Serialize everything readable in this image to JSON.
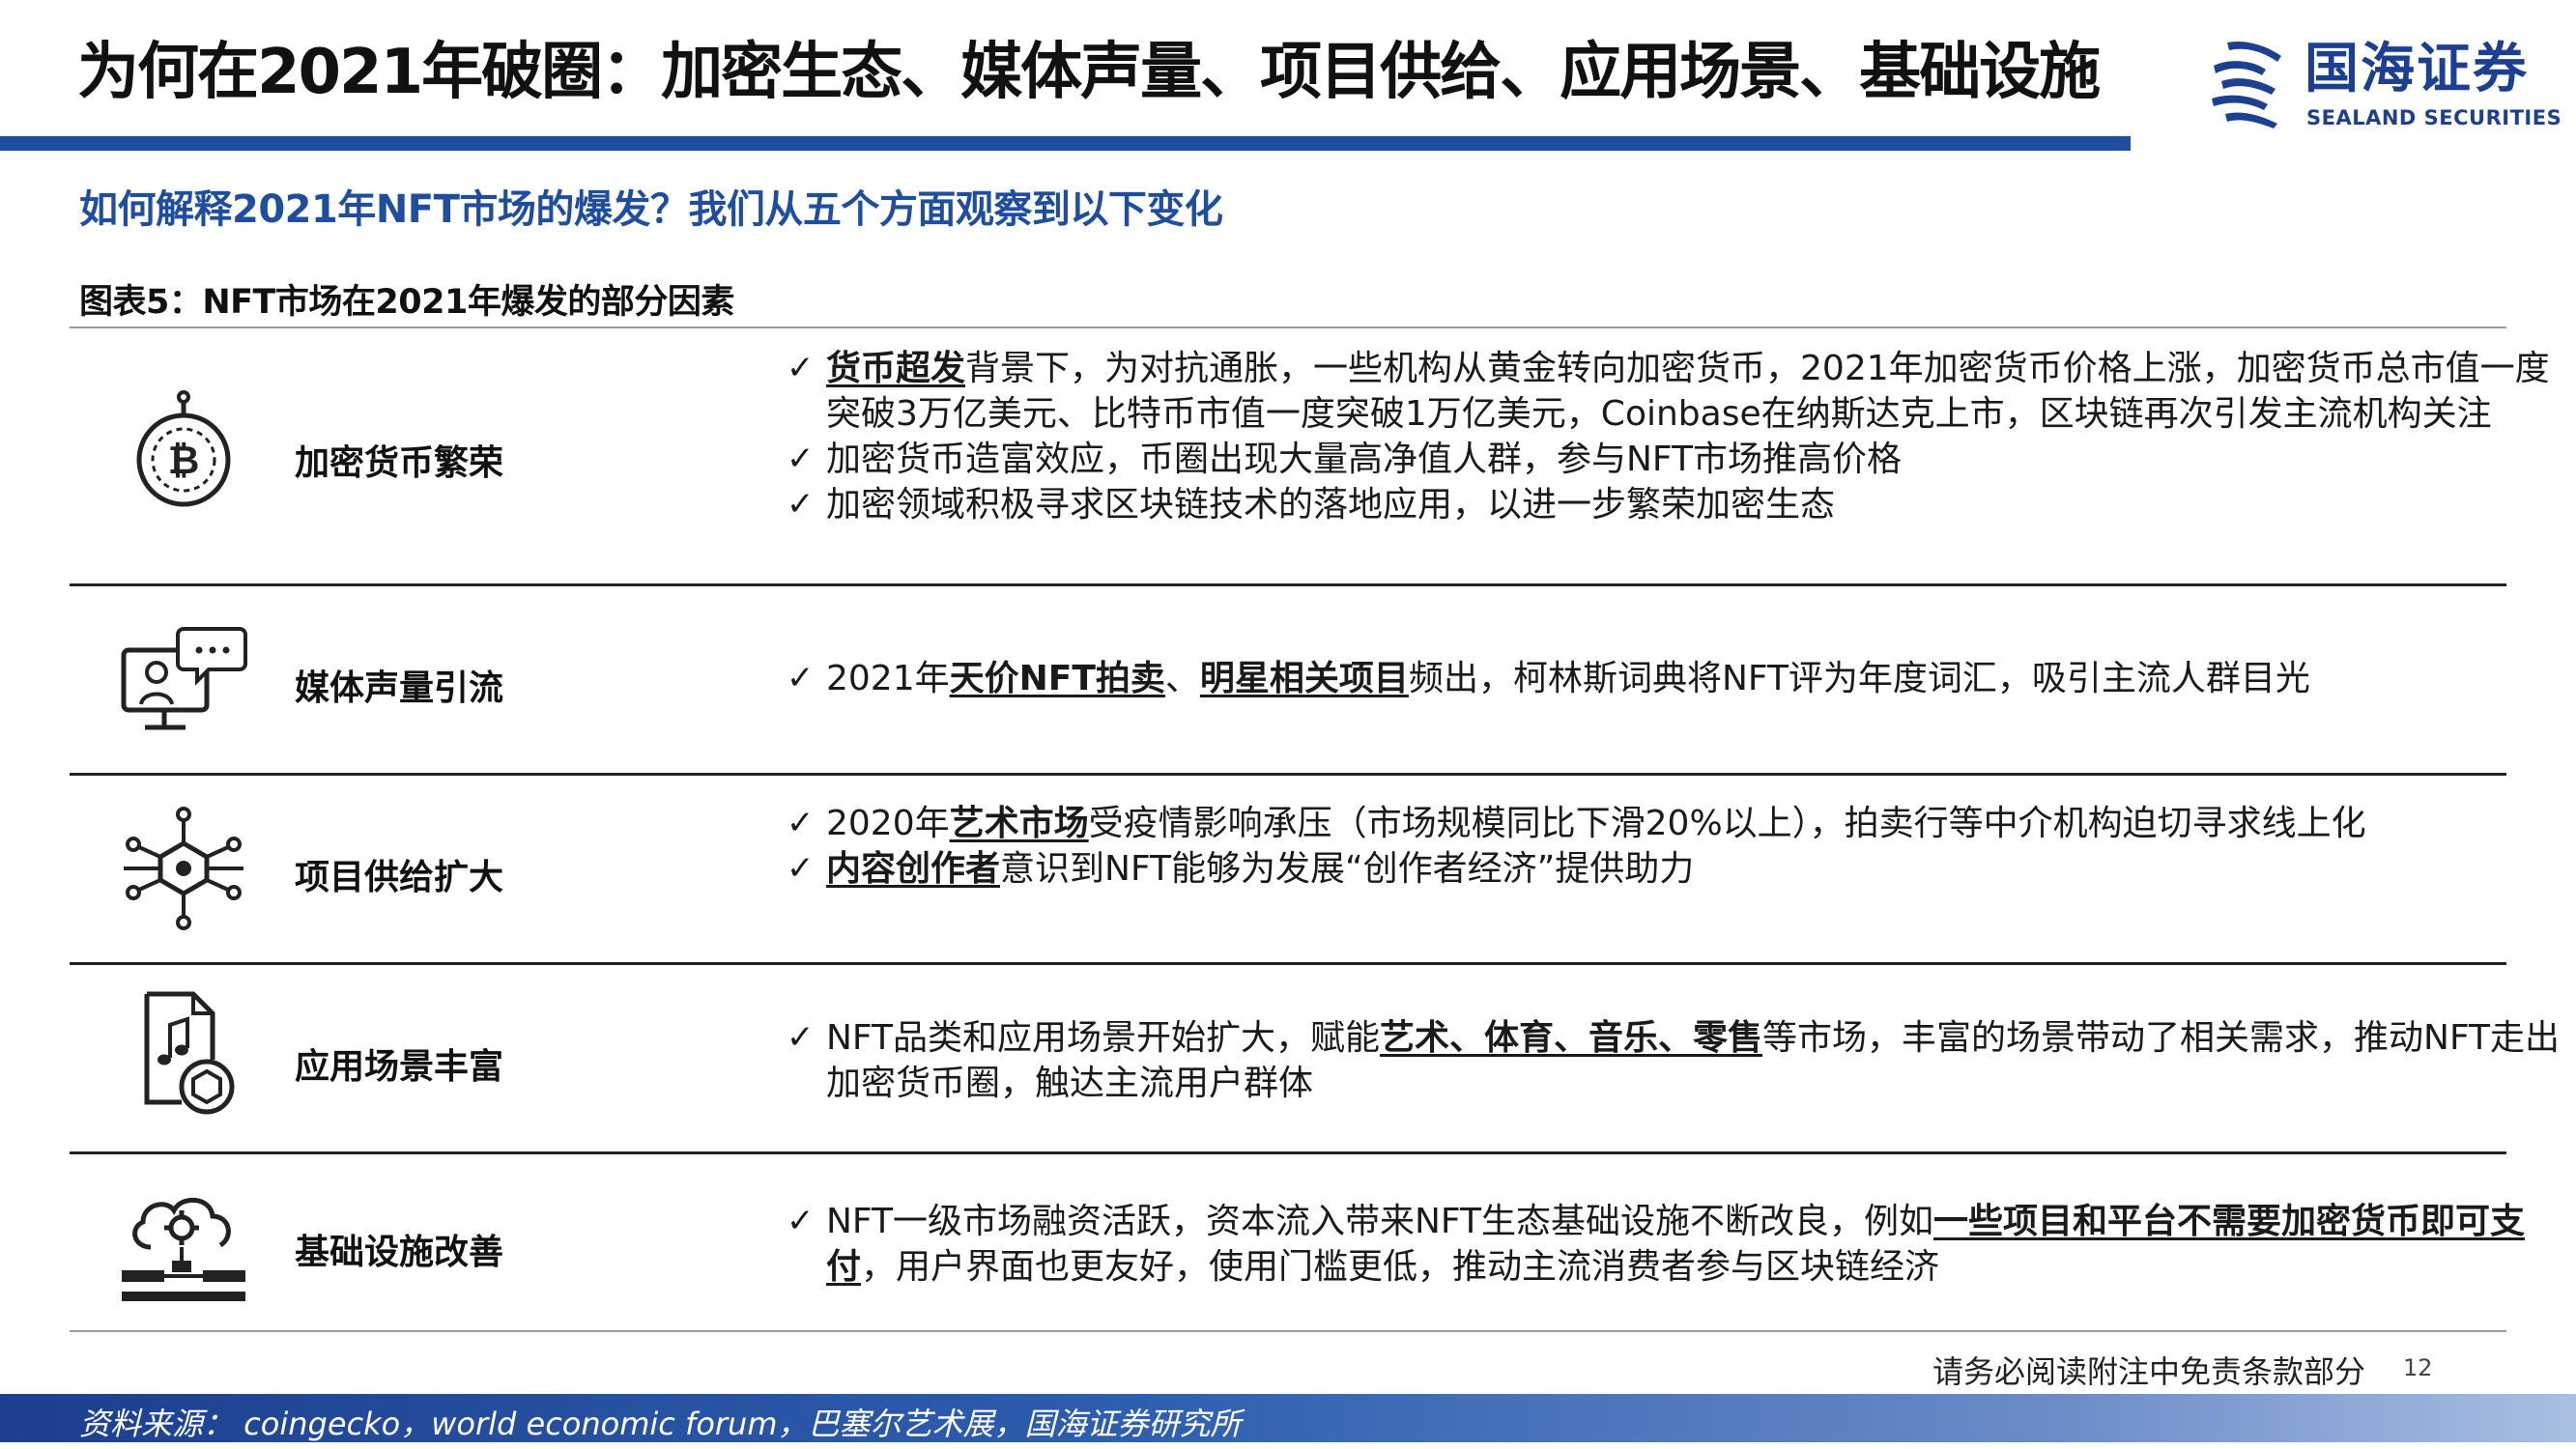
{
  "header": {
    "title": "为何在2021年破圈：加密生态、媒体声量、项目供给、应用场景、基础设施",
    "logo_cn": "国海证券",
    "logo_en": "SEALAND SECURITIES"
  },
  "subtitle": "如何解释2021年NFT市场的爆发？我们从五个方面观察到以下变化",
  "figure_caption": "图表5：NFT市场在2021年爆发的部分因素",
  "check_mark": "✓",
  "rows": [
    {
      "icon": "bitcoin-coin-icon",
      "label": "加密货币繁荣",
      "bullets": [
        [
          {
            "t": "货币超发",
            "hl": true
          },
          {
            "t": "背景下，为对抗通胀，一些机构从黄金转向加密货币，2021年加密货币价格上涨，加密货币总市值一度突破3万亿美元、比特币市值一度突破1万亿美元，Coinbase在纳斯达克上市，区块链再次引发主流机构关注"
          }
        ],
        [
          {
            "t": "加密货币造富效应，币圈出现大量高净值人群，参与NFT市场推高价格"
          }
        ],
        [
          {
            "t": "加密领域积极寻求区块链技术的落地应用，以进一步繁荣加密生态"
          }
        ]
      ]
    },
    {
      "icon": "monitor-chat-icon",
      "label": "媒体声量引流",
      "bullets": [
        [
          {
            "t": "2021年"
          },
          {
            "t": "天价NFT拍卖",
            "hl": true
          },
          {
            "t": "、"
          },
          {
            "t": "明星相关项目",
            "hl": true
          },
          {
            "t": "频出，柯林斯词典将NFT评为年度词汇，吸引主流人群目光"
          }
        ]
      ]
    },
    {
      "icon": "network-hub-icon",
      "label": "项目供给扩大",
      "bullets": [
        [
          {
            "t": "2020年"
          },
          {
            "t": "艺术市场",
            "hl": true
          },
          {
            "t": "受疫情影响承压（市场规模同比下滑20%以上），拍卖行等中介机构迫切寻求线上化"
          }
        ],
        [
          {
            "t": "内容创作者",
            "hl": true
          },
          {
            "t": "意识到NFT能够为发展“创作者经济”提供助力"
          }
        ]
      ]
    },
    {
      "icon": "music-file-token-icon",
      "label": "应用场景丰富",
      "bullets": [
        [
          {
            "t": "NFT品类和应用场景开始扩大，赋能"
          },
          {
            "t": "艺术、体育、音乐、零售",
            "hl": true
          },
          {
            "t": "等市场，丰富的场景带动了相关需求，推动NFT走出加密货币圈，触达主流用户群体"
          }
        ]
      ]
    },
    {
      "icon": "cloud-infrastructure-icon",
      "label": "基础设施改善",
      "bullets": [
        [
          {
            "t": "NFT一级市场融资活跃，资本流入带来NFT生态基础设施不断改良，例如"
          },
          {
            "t": "一些项目和平台不需要加密货币即可支付",
            "hl": true
          },
          {
            "t": "，用户界面也更友好，使用门槛更低，推动主流消费者参与区块链经济"
          }
        ]
      ]
    }
  ],
  "footer": {
    "disclaimer": "请务必阅读附注中免责条款部分",
    "page_number": "12",
    "source": "资料来源： coingecko，world economic forum，巴塞尔艺术展，国海证券研究所"
  }
}
